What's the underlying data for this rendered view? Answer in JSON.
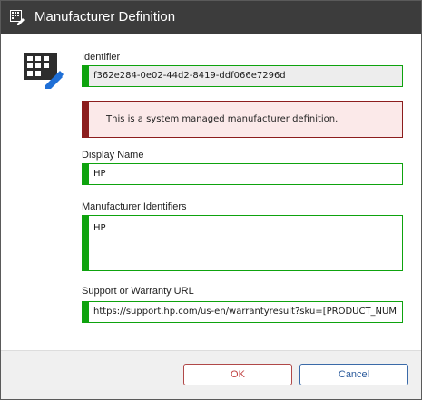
{
  "window": {
    "title": "Manufacturer Definition"
  },
  "icons": {
    "title": "manufacturer-edit-icon",
    "main": "building-edit-icon"
  },
  "form": {
    "identifier": {
      "label": "Identifier",
      "value": "f362e284-0e02-44d2-8419-ddf066e7296d",
      "readonly": true
    },
    "banner": {
      "text": "This is a system managed manufacturer definition."
    },
    "display_name": {
      "label": "Display Name",
      "value": "HP"
    },
    "manufacturer_identifiers": {
      "label": "Manufacturer Identifiers",
      "value": "HP"
    },
    "support_url": {
      "label": "Support or Warranty URL",
      "value": "https://support.hp.com/us-en/warrantyresult?sku=[PRODUCT_NUM"
    }
  },
  "buttons": {
    "ok": "OK",
    "cancel": "Cancel"
  },
  "colors": {
    "titlebar": "#3c3c3c",
    "valid_accent": "#0ea30e",
    "warning_accent": "#8c1d1d",
    "warning_bg": "#fbe9e9",
    "ok_border": "#b04848",
    "cancel_border": "#3a6aa8"
  }
}
